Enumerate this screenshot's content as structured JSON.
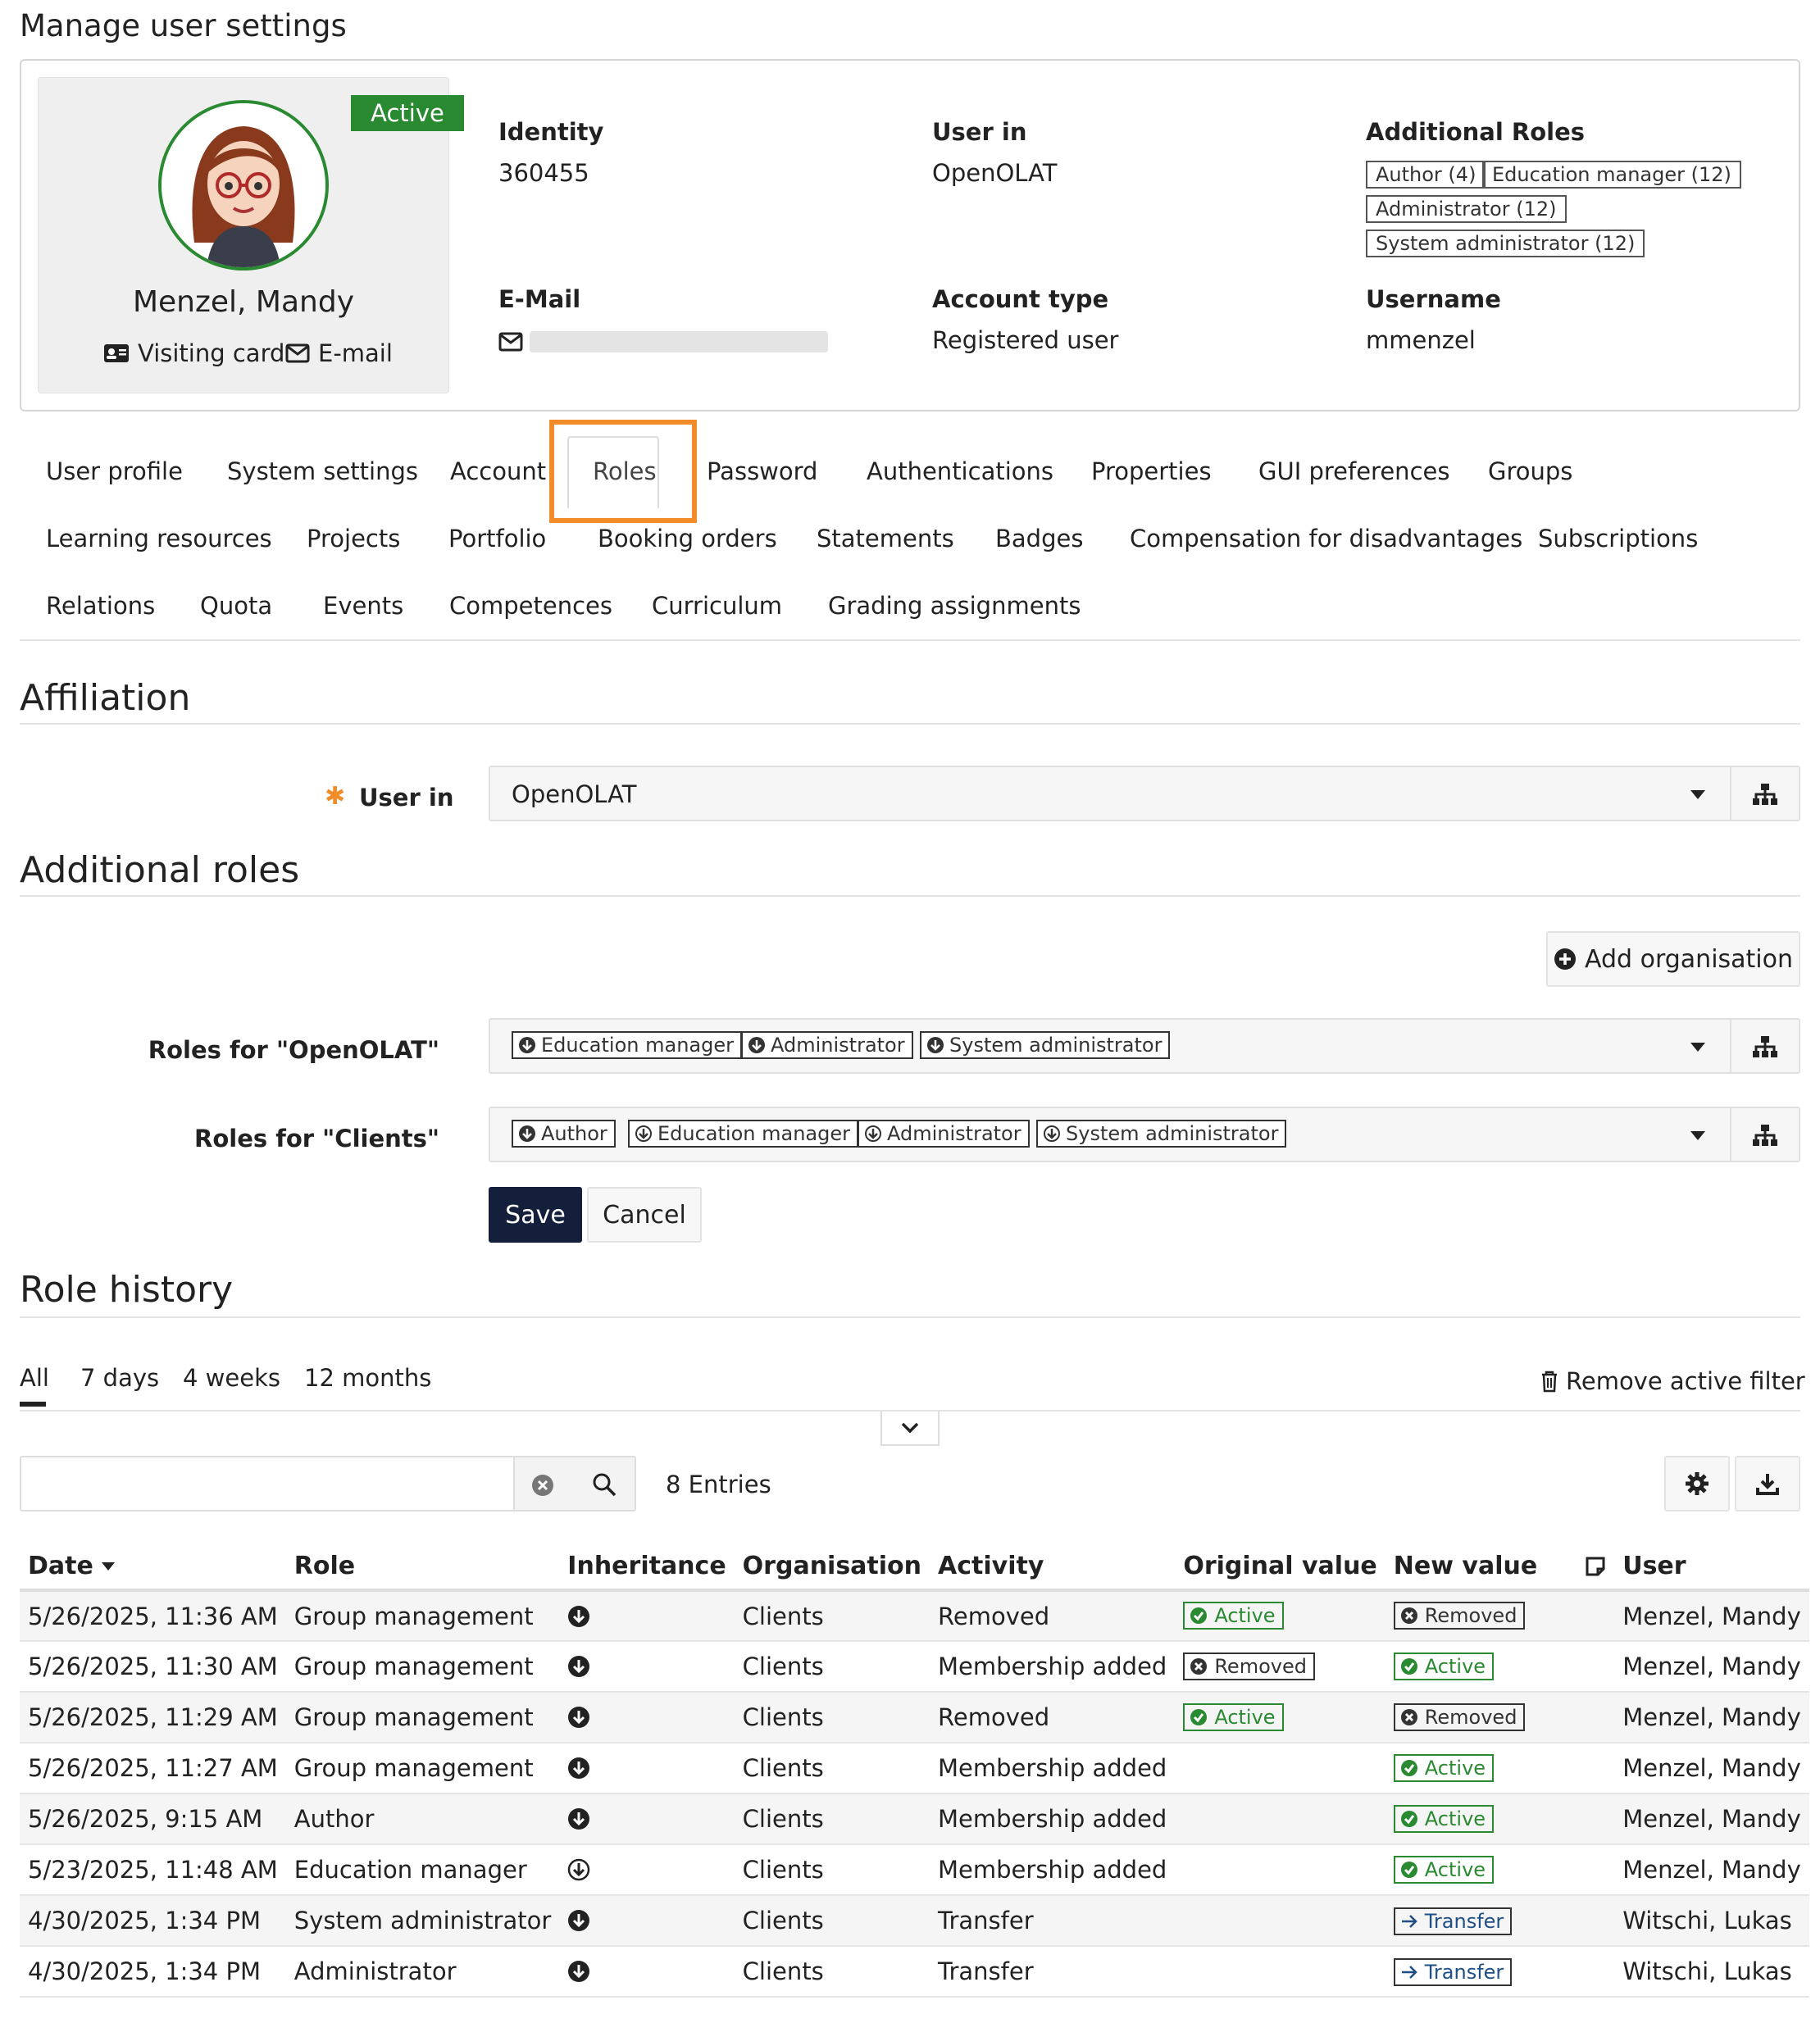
{
  "page": {
    "title": "Manage user settings"
  },
  "profile": {
    "status": "Active",
    "name": "Menzel, Mandy",
    "visiting_card": "Visiting card",
    "email_link": "E-mail",
    "identity_label": "Identity",
    "identity_value": "360455",
    "user_in_label": "User in",
    "user_in_value": "OpenOLAT",
    "additional_roles_label": "Additional Roles",
    "additional_roles": [
      "Author (4)",
      "Education manager (12)",
      "Administrator (12)",
      "System administrator (12)"
    ],
    "email_label": "E-Mail",
    "account_type_label": "Account type",
    "account_type_value": "Registered user",
    "username_label": "Username",
    "username_value": "mmenzel"
  },
  "tabs": {
    "row1": [
      "User profile",
      "System settings",
      "Account",
      "Roles",
      "Password",
      "Authentications",
      "Properties",
      "GUI preferences",
      "Groups"
    ],
    "row2": [
      "Learning resources",
      "Projects",
      "Portfolio",
      "Booking orders",
      "Statements",
      "Badges",
      "Compensation for disadvantages",
      "Subscriptions"
    ],
    "row3": [
      "Relations",
      "Quota",
      "Events",
      "Competences",
      "Curriculum",
      "Grading assignments"
    ],
    "active": "Roles"
  },
  "affiliation": {
    "title": "Affiliation",
    "required_mark": "✱",
    "user_in_label": "User in",
    "user_in_value": "OpenOLAT"
  },
  "additional_roles": {
    "title": "Additional roles",
    "add_org_button": "Add organisation",
    "openolat_label": "Roles for \"OpenOLAT\"",
    "openolat_roles": [
      "Education manager",
      "Administrator",
      "System administrator"
    ],
    "clients_label": "Roles for \"Clients\"",
    "clients_roles": [
      "Author",
      "Education manager",
      "Administrator",
      "System administrator"
    ],
    "save": "Save",
    "cancel": "Cancel"
  },
  "history": {
    "title": "Role history",
    "filters": [
      "All",
      "7 days",
      "4 weeks",
      "12 months"
    ],
    "active_filter": "All",
    "remove_filter": "Remove active filter",
    "entries": "8 Entries",
    "columns": [
      "Date",
      "Role",
      "Inheritance",
      "Organisation",
      "Activity",
      "Original value",
      "New value",
      "User"
    ],
    "rows": [
      {
        "date": "5/26/2025, 11:36 AM",
        "role": "Group management",
        "org": "Clients",
        "activity": "Removed",
        "orig": "Active",
        "new": "Removed",
        "user": "Menzel, Mandy"
      },
      {
        "date": "5/26/2025, 11:30 AM",
        "role": "Group management",
        "org": "Clients",
        "activity": "Membership added",
        "orig": "Removed",
        "new": "Active",
        "user": "Menzel, Mandy"
      },
      {
        "date": "5/26/2025, 11:29 AM",
        "role": "Group management",
        "org": "Clients",
        "activity": "Removed",
        "orig": "Active",
        "new": "Removed",
        "user": "Menzel, Mandy"
      },
      {
        "date": "5/26/2025, 11:27 AM",
        "role": "Group management",
        "org": "Clients",
        "activity": "Membership added",
        "orig": "",
        "new": "Active",
        "user": "Menzel, Mandy"
      },
      {
        "date": "5/26/2025, 9:15 AM",
        "role": "Author",
        "org": "Clients",
        "activity": "Membership added",
        "orig": "",
        "new": "Active",
        "user": "Menzel, Mandy"
      },
      {
        "date": "5/23/2025, 11:48 AM",
        "role": "Education manager",
        "org": "Clients",
        "activity": "Membership added",
        "orig": "",
        "new": "Active",
        "user": "Menzel, Mandy"
      },
      {
        "date": "4/30/2025, 1:34 PM",
        "role": "System administrator",
        "org": "Clients",
        "activity": "Transfer",
        "orig": "",
        "new": "Transfer",
        "user": "Witschi, Lukas"
      },
      {
        "date": "4/30/2025, 1:34 PM",
        "role": "Administrator",
        "org": "Clients",
        "activity": "Transfer",
        "orig": "",
        "new": "Transfer",
        "user": "Witschi, Lukas"
      }
    ]
  },
  "colors": {
    "accent": "#2a8a31",
    "primary": "#14203b",
    "highlight": "#f28c28"
  }
}
